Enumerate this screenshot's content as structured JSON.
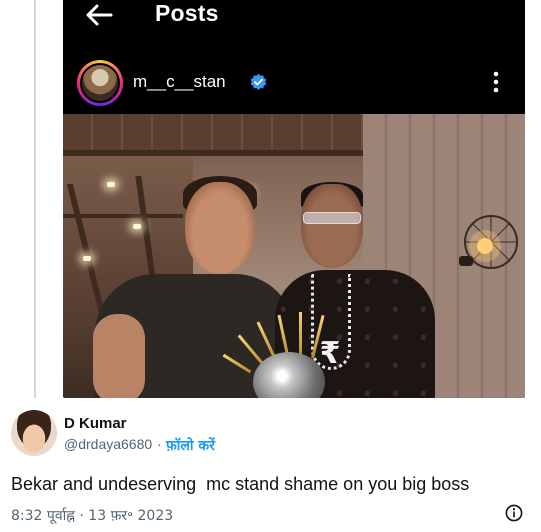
{
  "embed": {
    "topbar": {
      "title": "Posts"
    },
    "post_header": {
      "username": "m__c__stan"
    }
  },
  "tweet": {
    "author_name": "D Kumar",
    "author_handle": "@drdaya6680",
    "separator": "·",
    "follow_label": "फ़ॉलो करें",
    "text": "Bekar and undeserving  mc stand shame on you big boss",
    "timestamp": "8:32 पूर्वाह्न · 13 फ़र॰ 2023"
  },
  "icons": {
    "back": "arrow-left-icon",
    "verified": "verified-badge-icon",
    "more": "more-vertical-icon",
    "info": "info-icon"
  },
  "colors": {
    "link": "#1d9bf0",
    "secondary_text": "#536471",
    "verified": "#3897f0"
  },
  "pendant_glyph": "₹"
}
